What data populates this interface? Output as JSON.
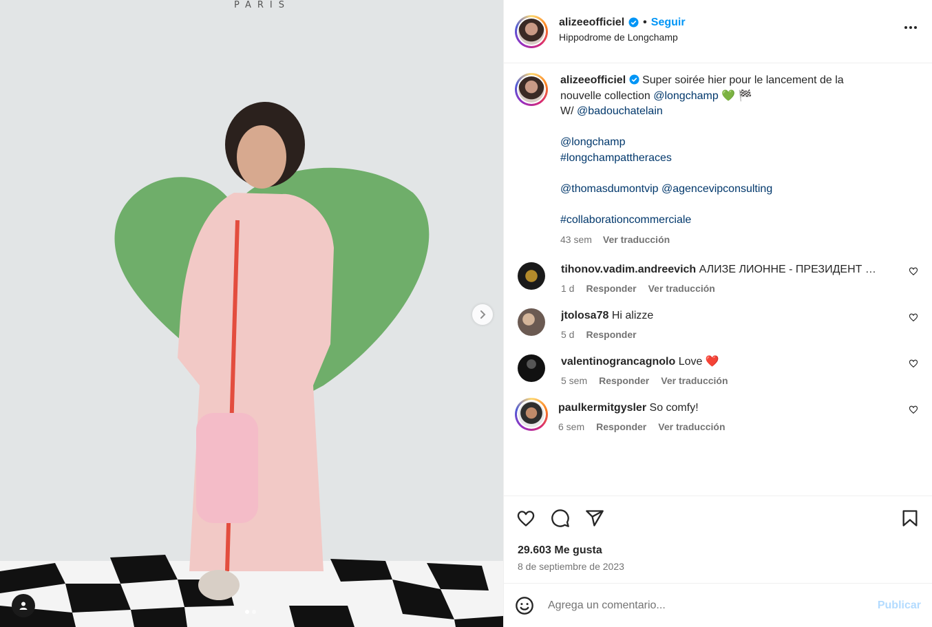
{
  "media": {
    "brand_text": "PARIS",
    "icons": {
      "next": "chevron-right-icon",
      "tag": "user-tag-icon"
    },
    "slide_count": 2,
    "active_slide": 1
  },
  "header": {
    "username": "alizeeofficiel",
    "separator": "•",
    "follow_label": "Seguir",
    "location": "Hippodrome de Longchamp",
    "more_icon": "more-horizontal-icon"
  },
  "caption": {
    "username": "alizeeofficiel",
    "text_1": "Super soirée hier pour le lancement de la nouvelle collection ",
    "mention_longchamp": "@longchamp",
    "emojis": " 💚 🏁",
    "with_prefix": "W/ ",
    "mention_badou": "@badouchatelain",
    "mention_longchamp_2": "@longchamp",
    "hashtag_1": "#longchampattheraces",
    "mention_thomas": "@thomasdumontvip",
    "mention_agence": "@agencevipconsulting",
    "hashtag_2": "#collaborationcommerciale",
    "time": "43 sem",
    "translate": "Ver traducción"
  },
  "comments": [
    {
      "username": "tihonov.vadim.andreevich",
      "text": "АЛИЗЕ ЛИОННЕ - ПРЕЗИДЕНТ ФРАНЦИИ",
      "time": "1 d",
      "reply": "Responder",
      "translate": "Ver traducción",
      "avatar_color": "#1a1a1a"
    },
    {
      "username": "jtolosa78",
      "text": "Hi alizze",
      "time": "5 d",
      "reply": "Responder",
      "avatar_color": "#6b5a52"
    },
    {
      "username": "valentinograncagnolo",
      "text": "Love ❤️",
      "time": "5 sem",
      "reply": "Responder",
      "translate": "Ver traducción",
      "avatar_color": "#111111"
    },
    {
      "username": "paulkermitgysler",
      "text": "So comfy!",
      "time": "6 sem",
      "reply": "Responder",
      "translate": "Ver traducción",
      "avatar_color": "#3a3a3a"
    }
  ],
  "actions": {
    "icons": [
      "heart-icon",
      "comment-icon",
      "share-icon",
      "bookmark-icon"
    ],
    "likes": "29.603 Me gusta",
    "date": "8 de septiembre de 2023"
  },
  "add_comment": {
    "placeholder": "Agrega un comentario...",
    "publish_label": "Publicar",
    "emoji_icon": "emoji-icon"
  },
  "colors": {
    "follow_blue": "#0095f6",
    "link_blue": "#00376b",
    "muted": "#737373",
    "publish_disabled": "#b3dbff"
  }
}
